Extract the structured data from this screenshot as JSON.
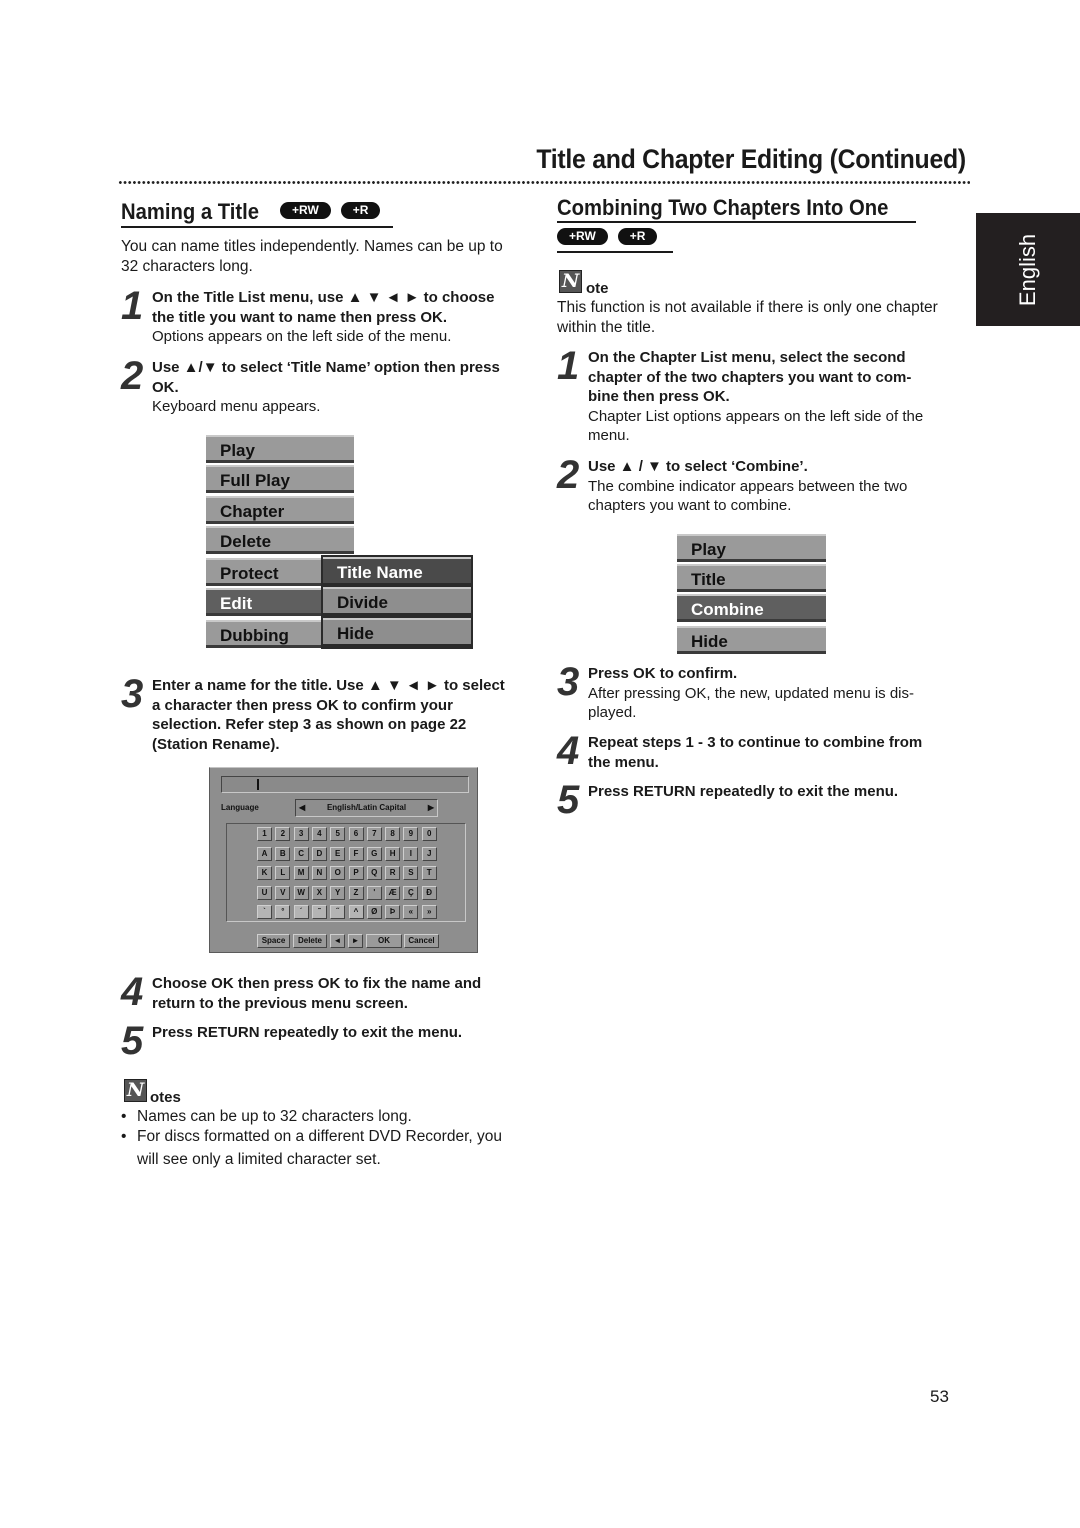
{
  "header": {
    "title": "Title and Chapter Editing (Continued)"
  },
  "language_tab": "English",
  "page_number": "53",
  "left": {
    "heading": "Naming a Title",
    "badges": [
      "+RW",
      "+R"
    ],
    "intro": [
      "You can name titles independently. Names can be up to",
      "32 characters long."
    ],
    "steps": [
      {
        "num": "1",
        "bold": [
          "On the Title List menu, use ▲ ▼ ◄ ► to choose",
          "the title you want to name then press OK."
        ],
        "plain": [
          "Options appears on the left side of the menu."
        ]
      },
      {
        "num": "2",
        "bold": [
          "Use ▲/▼ to select ‘Title Name’ option then press",
          "OK."
        ],
        "plain": [
          "Keyboard menu appears."
        ]
      },
      {
        "num": "3",
        "bold": [
          "Enter a name for the title. Use ▲ ▼ ◄ ► to select",
          "a character then press OK to confirm your",
          "selection. Refer step 3 as shown on page 22",
          "(Station Rename)."
        ],
        "plain": []
      },
      {
        "num": "4",
        "bold": [
          "Choose OK then press OK to fix the name and",
          "return to the previous menu screen."
        ],
        "plain": []
      },
      {
        "num": "5",
        "bold": [
          "Press RETURN repeatedly to exit the menu."
        ],
        "plain": []
      }
    ],
    "title_menu": {
      "items": [
        "Play",
        "Full Play",
        "Chapter",
        "Delete",
        "Protect",
        "Edit",
        "Dubbing"
      ],
      "selected": "Edit",
      "submenu": [
        "Title Name",
        "Divide",
        "Hide"
      ],
      "submenu_selected": "Title Name"
    },
    "keyboard": {
      "name_value": "",
      "language_label": "Language",
      "language_value": "English/Latin Capital",
      "rows": [
        [
          "1",
          "2",
          "3",
          "4",
          "5",
          "6",
          "7",
          "8",
          "9",
          "0"
        ],
        [
          "A",
          "B",
          "C",
          "D",
          "E",
          "F",
          "G",
          "H",
          "I",
          "J"
        ],
        [
          "K",
          "L",
          "M",
          "N",
          "O",
          "P",
          "Q",
          "R",
          "S",
          "T"
        ],
        [
          "U",
          "V",
          "W",
          "X",
          "Y",
          "Z",
          "'",
          "Æ",
          "Ç",
          "Đ"
        ],
        [
          "`",
          "°",
          "´",
          "˜",
          "˝",
          "^",
          "Ø",
          "Þ",
          "«",
          "»"
        ]
      ],
      "function_keys": [
        "Space",
        "Delete",
        "◄",
        "►",
        "OK",
        "Cancel"
      ]
    },
    "notes_label": "otes",
    "notes": [
      "Names can be up to 32 characters long.",
      "For discs formatted on a different DVD Recorder, you",
      "will see only a limited character set."
    ]
  },
  "right": {
    "heading": "Combining Two Chapters Into One",
    "badges": [
      "+RW",
      "+R"
    ],
    "note_label": "ote",
    "note_text": [
      "This function is not available if there is only one chapter",
      "within the title."
    ],
    "steps": [
      {
        "num": "1",
        "bold": [
          "On the Chapter List menu, select the second",
          "chapter of the two chapters you want to com-",
          "bine then press OK."
        ],
        "plain": [
          "Chapter List options appears on the left side of the",
          "menu."
        ]
      },
      {
        "num": "2",
        "bold": [
          "Use ▲ / ▼ to select ‘Combine’."
        ],
        "plain": [
          "The combine indicator appears between the two",
          "chapters you want to combine."
        ]
      },
      {
        "num": "3",
        "bold": [
          "Press OK to confirm."
        ],
        "plain": [
          "After pressing OK, the new, updated menu is dis-",
          "played."
        ]
      },
      {
        "num": "4",
        "bold": [
          "Repeat steps 1 - 3 to continue to combine from",
          "the menu."
        ],
        "plain": []
      },
      {
        "num": "5",
        "bold": [
          "Press RETURN repeatedly to exit the menu."
        ],
        "plain": []
      }
    ],
    "chapter_menu": {
      "items": [
        "Play",
        "Title",
        "Combine",
        "Hide"
      ],
      "selected": "Combine"
    }
  }
}
